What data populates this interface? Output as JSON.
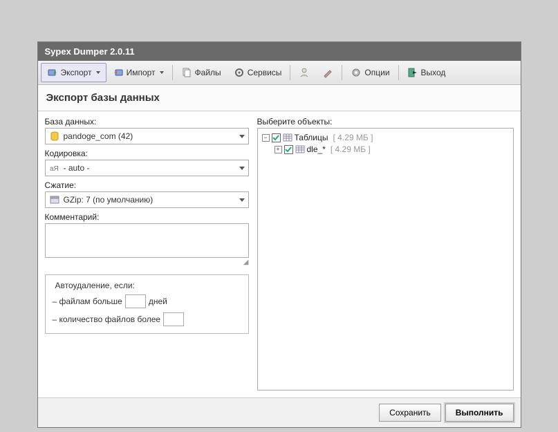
{
  "window": {
    "title": "Sypex Dumper 2.0.11"
  },
  "toolbar": {
    "export": "Экспорт",
    "import": "Импорт",
    "files": "Файлы",
    "services": "Сервисы",
    "options": "Опции",
    "exit": "Выход"
  },
  "section": {
    "title": "Экспорт базы данных"
  },
  "left": {
    "db_label": "База данных:",
    "db_value": "pandoge_com (42)",
    "encoding_label": "Кодировка:",
    "encoding_value": "- auto -",
    "compress_label": "Сжатие:",
    "compress_value": "GZip: 7 (по умолчанию)",
    "comment_label": "Комментарий:",
    "autodel_legend": "Автоудаление, если:",
    "autodel_days_prefix": "– файлам больше",
    "autodel_days_suffix": "дней",
    "autodel_count_prefix": "– количество файлов более"
  },
  "right": {
    "objects_label": "Выберите объекты:",
    "tree": {
      "tables_label": "Таблицы",
      "tables_size": "[ 4.29 МБ ]",
      "child_label": "dle_*",
      "child_size": "[ 4.29 МБ ]"
    }
  },
  "footer": {
    "save": "Сохранить",
    "run": "Выполнить"
  }
}
